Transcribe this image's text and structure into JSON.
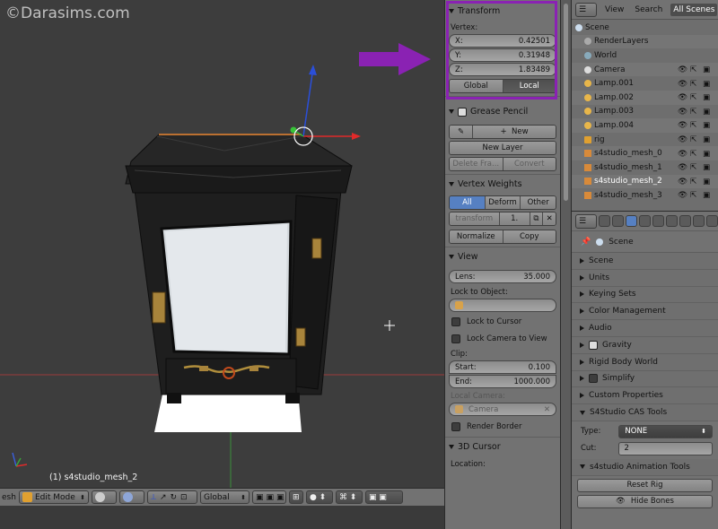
{
  "watermark": "©Darasims.com",
  "viewport": {
    "object_label": "(1) s4studio_mesh_2"
  },
  "header3d": {
    "mesh_label": "esh",
    "mode": "Edit Mode",
    "orientation": "Global"
  },
  "npanel": {
    "transform": {
      "title": "Transform",
      "vertex_label": "Vertex:",
      "x_label": "X:",
      "x_value": "0.42501",
      "y_label": "Y:",
      "y_value": "0.31948",
      "z_label": "Z:",
      "z_value": "1.83489",
      "global": "Global",
      "local": "Local"
    },
    "grease_pencil": {
      "title": "Grease Pencil",
      "new": "New",
      "new_layer": "New Layer",
      "delete_frame": "Delete Fra...",
      "convert": "Convert"
    },
    "vertex_weights": {
      "title": "Vertex Weights",
      "all": "All",
      "deform": "Deform",
      "other": "Other",
      "transform": "transform",
      "value": "1.",
      "normalize": "Normalize",
      "copy": "Copy"
    },
    "view": {
      "title": "View",
      "lens_label": "Lens:",
      "lens_value": "35.000",
      "lock_to_object": "Lock to Object:",
      "lock_to_cursor": "Lock to Cursor",
      "lock_camera": "Lock Camera to View",
      "clip": "Clip:",
      "start_label": "Start:",
      "start_value": "0.100",
      "end_label": "End:",
      "end_value": "1000.000",
      "local_camera": "Local Camera:",
      "camera": "Camera",
      "render_border": "Render Border"
    },
    "cursor": {
      "title": "3D Cursor",
      "location": "Location:"
    }
  },
  "outliner": {
    "tabs": [
      "View",
      "Search",
      "All Scenes"
    ],
    "rows": [
      {
        "name": "Scene",
        "indent": 0
      },
      {
        "name": "RenderLayers",
        "indent": 1
      },
      {
        "name": "World",
        "indent": 1
      },
      {
        "name": "Camera",
        "indent": 1
      },
      {
        "name": "Lamp.001",
        "indent": 1
      },
      {
        "name": "Lamp.002",
        "indent": 1
      },
      {
        "name": "Lamp.003",
        "indent": 1
      },
      {
        "name": "Lamp.004",
        "indent": 1
      },
      {
        "name": "rig",
        "indent": 1
      },
      {
        "name": "s4studio_mesh_0",
        "indent": 1
      },
      {
        "name": "s4studio_mesh_1",
        "indent": 1
      },
      {
        "name": "s4studio_mesh_2",
        "indent": 1
      },
      {
        "name": "s4studio_mesh_3",
        "indent": 1
      }
    ]
  },
  "properties": {
    "scene_label": "Scene",
    "panels": [
      "Scene",
      "Units",
      "Keying Sets",
      "Color Management",
      "Audio",
      "Gravity",
      "Rigid Body World",
      "Simplify",
      "Custom Properties"
    ],
    "s4_cas": {
      "title": "S4Studio CAS Tools",
      "type_label": "Type:",
      "type_value": "NONE",
      "cut_label": "Cut:",
      "cut_value": "2"
    },
    "s4_anim": {
      "title": "s4studio Animation Tools",
      "reset_rig": "Reset Rig",
      "hide_bones": "Hide Bones"
    }
  },
  "colors": {
    "annotation_purple": "#8a22b3",
    "accent_blue": "#5680c2",
    "axis_red": "#d23a3a",
    "axis_green": "#3aa53a",
    "axis_blue": "#2b4fd9"
  }
}
